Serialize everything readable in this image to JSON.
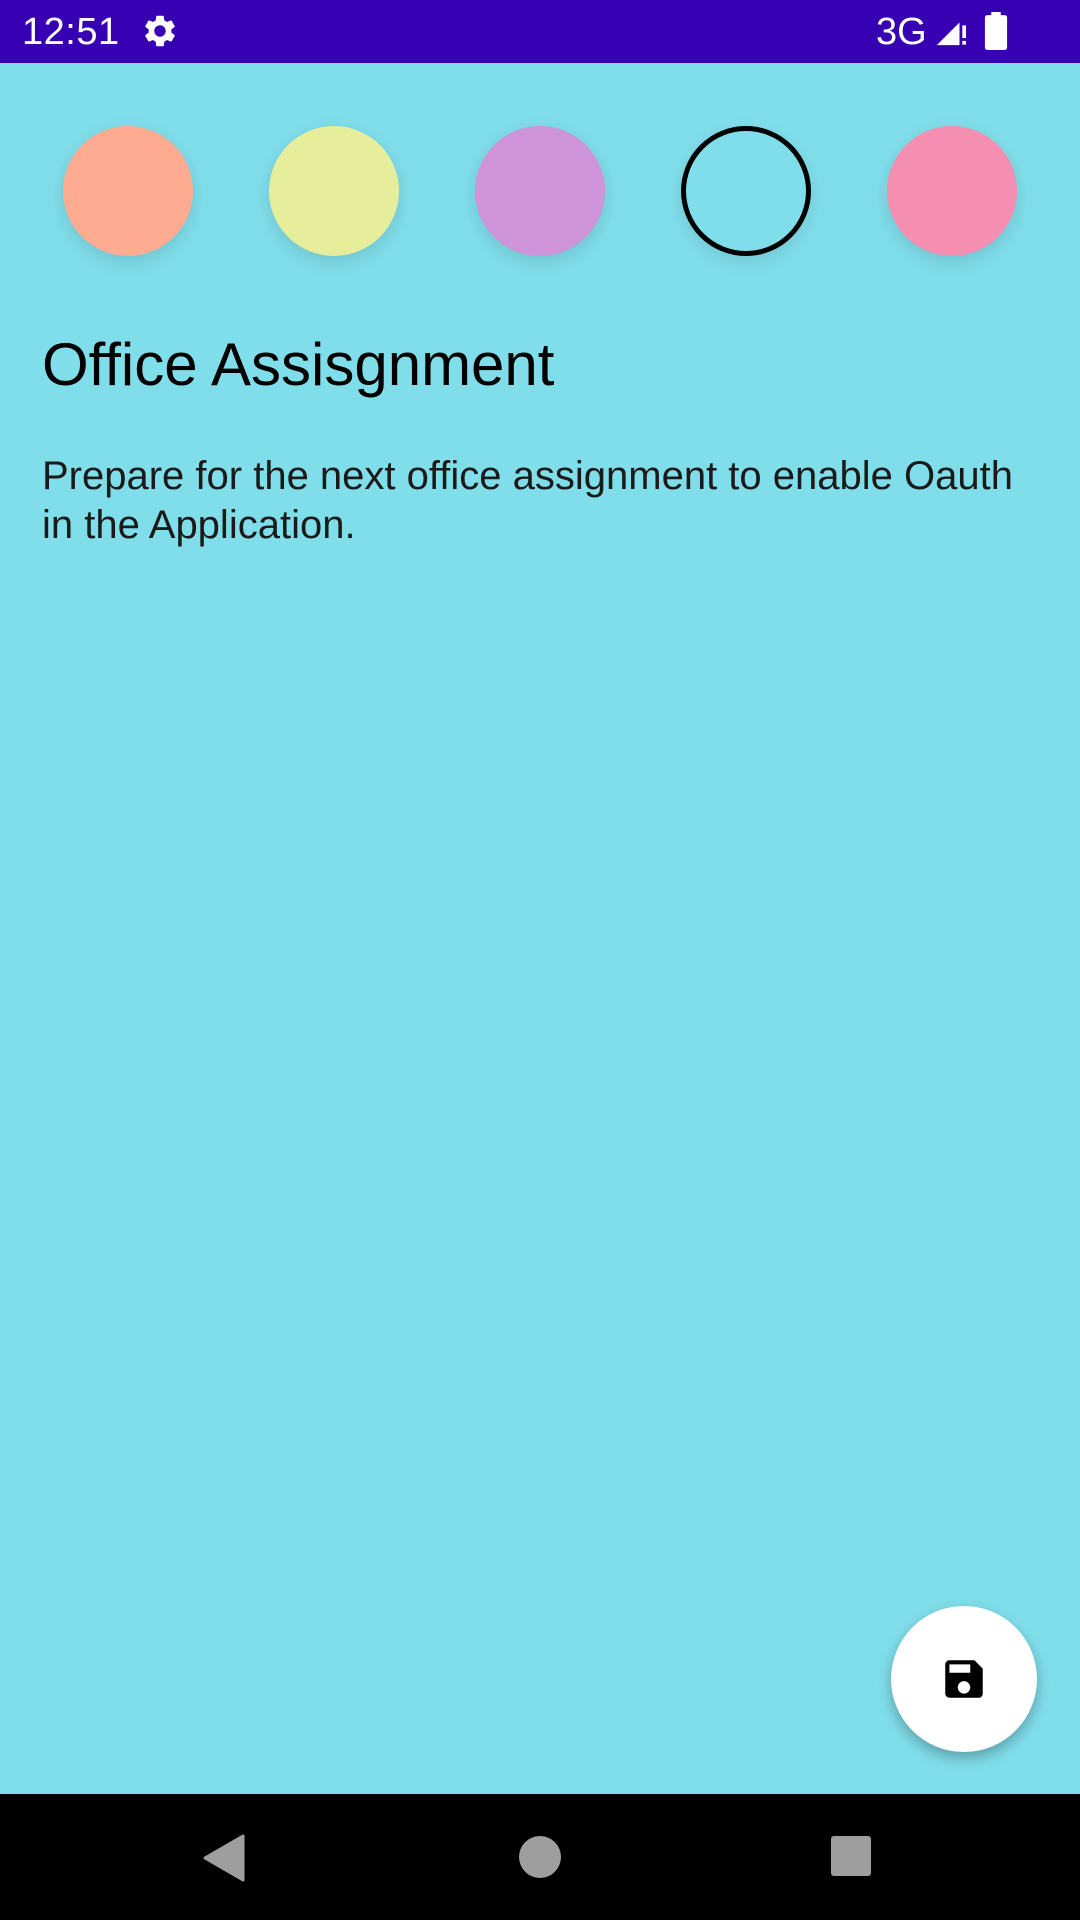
{
  "status_bar": {
    "time": "12:51",
    "network": "3G",
    "icons": [
      "settings-gear-icon",
      "cell-signal-icon",
      "battery-full-icon"
    ],
    "background": "#3700b3"
  },
  "color_picker": {
    "swatches": [
      {
        "color": "#ffab91",
        "selected": false
      },
      {
        "color": "#e6ee9b",
        "selected": false
      },
      {
        "color": "#ce93d8",
        "selected": false
      },
      {
        "color": "#80deea",
        "selected": true
      },
      {
        "color": "#f48fb1",
        "selected": false
      }
    ]
  },
  "note": {
    "title": "Office Assisgnment",
    "body": "Prepare for the next office assignment to enable Oauth in the Application.",
    "background": "#80deea"
  },
  "fab": {
    "icon": "save-floppy-icon"
  },
  "nav_bar": {
    "icons": [
      "back-triangle-icon",
      "home-circle-icon",
      "recents-square-icon"
    ]
  }
}
